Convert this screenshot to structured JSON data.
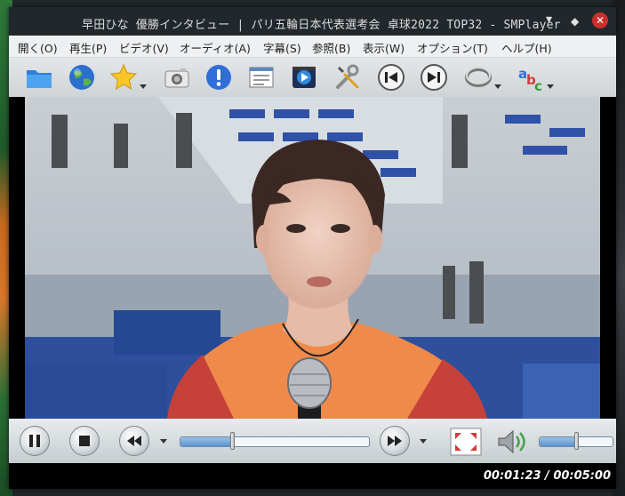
{
  "window": {
    "title": "早田ひな 優勝インタビュー | パリ五輪日本代表選考会 卓球2022 TOP32 - SMPlayer"
  },
  "menu": [
    {
      "label": "開く(O)"
    },
    {
      "label": "再生(P)"
    },
    {
      "label": "ビデオ(V)"
    },
    {
      "label": "オーディオ(A)"
    },
    {
      "label": "字幕(S)"
    },
    {
      "label": "参照(B)"
    },
    {
      "label": "表示(W)"
    },
    {
      "label": "オプション(T)"
    },
    {
      "label": "ヘルプ(H)"
    }
  ],
  "toolbar_icons": [
    "folder-icon",
    "globe-icon",
    "star-icon",
    "camera-icon",
    "info-icon",
    "playlist-icon",
    "media-icon",
    "settings-icon",
    "previous-icon",
    "next-icon",
    "loop-icon",
    "subtitles-icon"
  ],
  "playback": {
    "time_display": "00:01:23 / 00:05:00",
    "progress_fraction": 0.277,
    "volume_fraction": 0.5
  },
  "colors": {
    "titlebar": "#22272b",
    "accent": "#5f94cc",
    "jersey": "#f08a4a"
  }
}
